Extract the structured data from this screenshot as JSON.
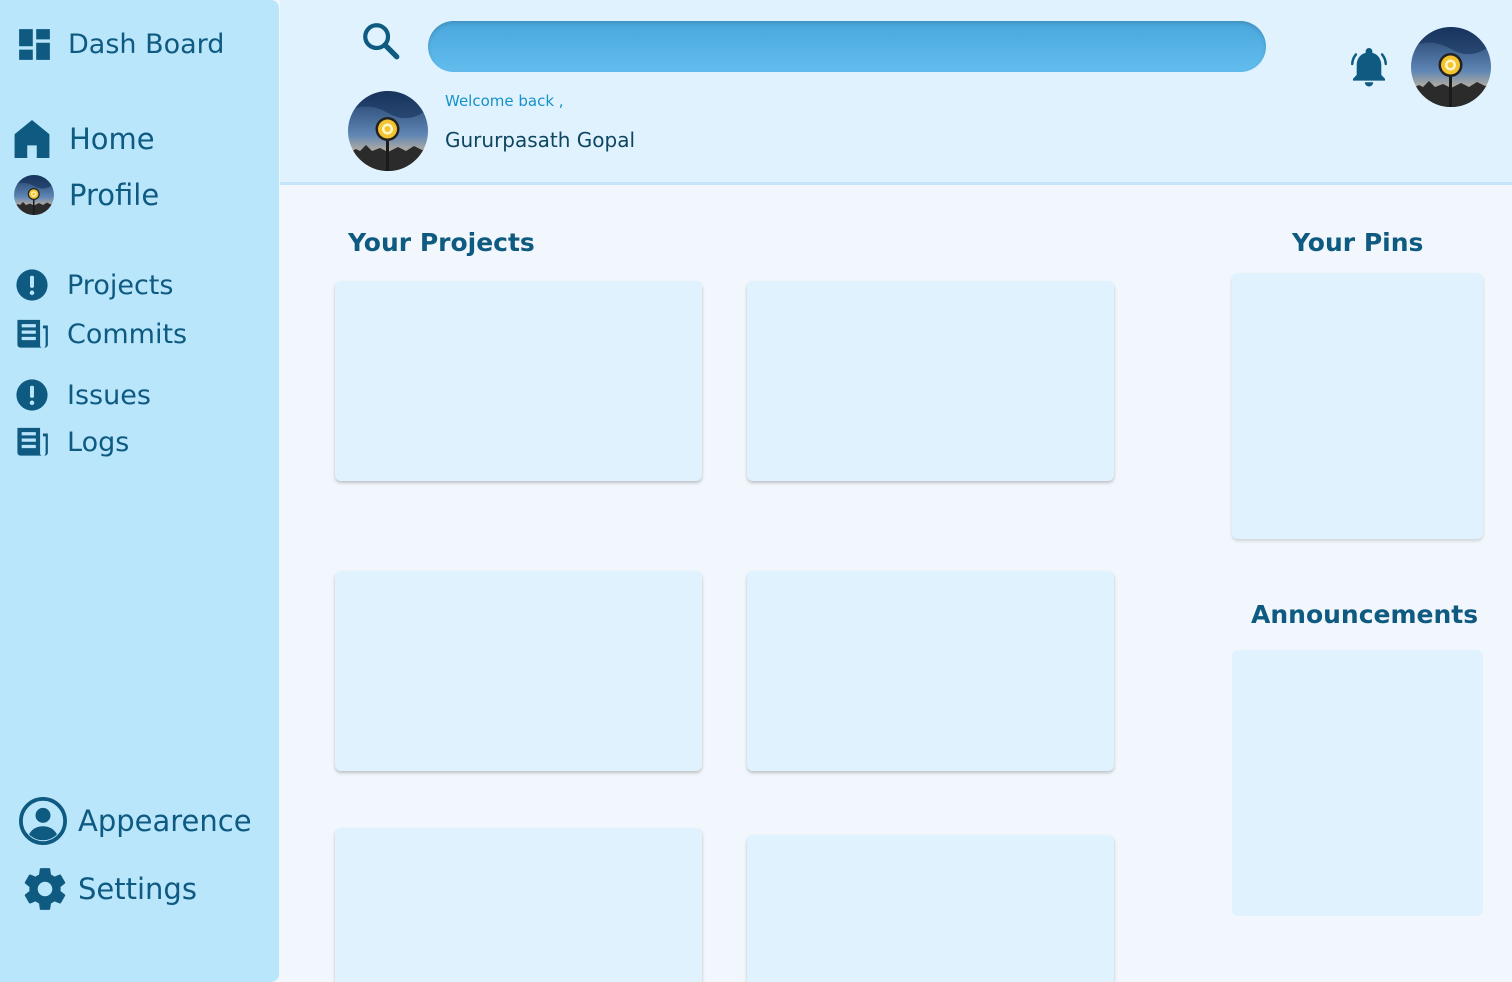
{
  "sidebar": {
    "brand": {
      "label": "Dash Board",
      "icon": "dashboard-icon"
    },
    "items": [
      {
        "label": "Home",
        "icon": "home-icon"
      },
      {
        "label": "Profile",
        "icon": "profile-avatar-icon"
      },
      {
        "label": "Projects",
        "icon": "exclamation-circle-icon"
      },
      {
        "label": "Commits",
        "icon": "newspaper-icon"
      },
      {
        "label": "Issues",
        "icon": "exclamation-circle-icon"
      },
      {
        "label": "Logs",
        "icon": "newspaper-icon"
      }
    ],
    "bottom_items": [
      {
        "label": "Appearence",
        "icon": "user-circle-icon"
      },
      {
        "label": "Settings",
        "icon": "gear-icon"
      }
    ]
  },
  "header": {
    "search": {
      "placeholder": "",
      "value": ""
    },
    "welcome": "Welcome back ,",
    "username": "Gururpasath Gopal"
  },
  "main": {
    "projects_title": "Your Projects",
    "pins_title": "Your Pins",
    "announcements_title": "Announcements"
  },
  "colors": {
    "sidebar_bg": "#bae6fc",
    "header_bg": "#e0f2fe",
    "card_bg": "#e0f2fe",
    "text": "#0e5a80",
    "accent": "#4aa7dc"
  }
}
